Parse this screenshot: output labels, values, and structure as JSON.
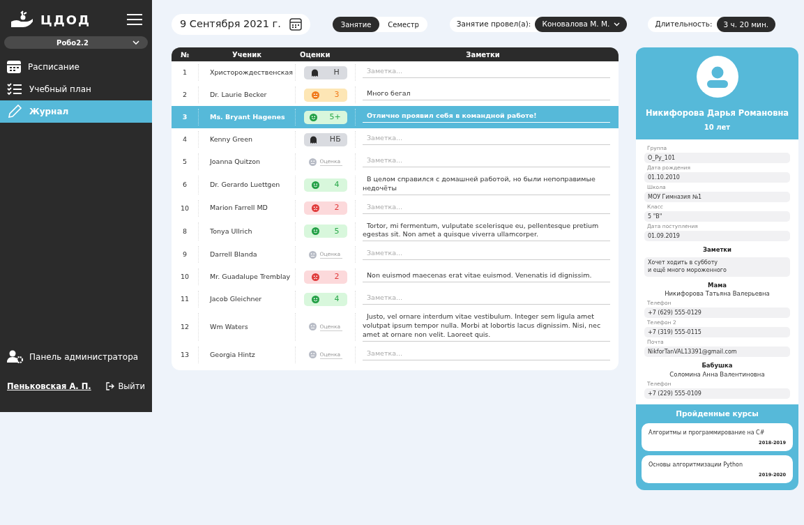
{
  "sidebar": {
    "logo": "ЦДОД",
    "group_select": "Робо2.2",
    "items": [
      {
        "label": "Расписание",
        "selected": false
      },
      {
        "label": "Учебный план",
        "selected": false
      },
      {
        "label": "Журнал",
        "selected": true
      }
    ],
    "admin": "Панель администратора",
    "user": "Пеньковская А. П.",
    "logout": "Выйти"
  },
  "toolbar": {
    "date": "9 Сентября 2021 г.",
    "modes": [
      {
        "label": "Занятие",
        "selected": true
      },
      {
        "label": "Семестр",
        "selected": false
      }
    ],
    "teacher_label": "Занятие провел(а):",
    "teacher": "Коновалова М. М.",
    "duration_label": "Длительность:",
    "duration": "3 ч. 20 мин."
  },
  "table": {
    "columns": [
      "№",
      "Ученик",
      "Оценки",
      "Заметки"
    ],
    "rows": [
      {
        "num": "1",
        "student": "Христорождественская",
        "grade": {
          "kind": "absent",
          "text": "Н"
        },
        "note": {
          "placeholder": "Заметка..."
        },
        "selected": false
      },
      {
        "num": "2",
        "student": "Dr. Laurie Becker",
        "grade": {
          "kind": "ok",
          "text": "3"
        },
        "note": {
          "value": "Много бегал"
        },
        "selected": false
      },
      {
        "num": "3",
        "student": "Ms. Bryant Hagenes",
        "grade": {
          "kind": "good",
          "text": "5+"
        },
        "note": {
          "value": "Отлично проявил себя в командной работе!"
        },
        "selected": true
      },
      {
        "num": "4",
        "student": "Kenny Green",
        "grade": {
          "kind": "absent",
          "text": "НБ"
        },
        "note": {
          "placeholder": "Заметка..."
        },
        "selected": false
      },
      {
        "num": "5",
        "student": "Joanna Quitzon",
        "grade": {
          "kind": "empty",
          "placeholder": "Оценка"
        },
        "note": {
          "placeholder": "Заметка..."
        },
        "selected": false
      },
      {
        "num": "6",
        "student": "Dr. Gerardo Luettgen",
        "grade": {
          "kind": "good",
          "text": "4"
        },
        "note": {
          "value": "В целом справился с домашней работой, но были непоправимые недочёты"
        },
        "selected": false
      },
      {
        "num": "10",
        "student": "Marion Farrell MD",
        "grade": {
          "kind": "bad",
          "text": "2"
        },
        "note": {
          "placeholder": "Заметка..."
        },
        "selected": false
      },
      {
        "num": "8",
        "student": "Tonya Ullrich",
        "grade": {
          "kind": "good",
          "text": "5"
        },
        "note": {
          "value": "Tortor, mi fermentum, vulputate scelerisque eu, pellentesque pretium egestas sit. Non amet a quisque viverra ullamcorper."
        },
        "selected": false
      },
      {
        "num": "9",
        "student": "Darrell Blanda",
        "grade": {
          "kind": "empty",
          "placeholder": "Оценка"
        },
        "note": {
          "placeholder": "Заметка..."
        },
        "selected": false
      },
      {
        "num": "10",
        "student": "Mr. Guadalupe Tremblay",
        "grade": {
          "kind": "bad",
          "text": "2"
        },
        "note": {
          "value": "Non euismod maecenas erat vitae euismod. Venenatis id dignissim."
        },
        "selected": false
      },
      {
        "num": "11",
        "student": "Jacob Gleichner",
        "grade": {
          "kind": "good",
          "text": "4"
        },
        "note": {
          "placeholder": "Заметка..."
        },
        "selected": false
      },
      {
        "num": "12",
        "student": "Wm Waters",
        "grade": {
          "kind": "empty",
          "placeholder": "Оценка"
        },
        "note": {
          "value": "Justo, vel ornare interdum vitae vestibulum. Integer sem ligula amet volutpat ipsum tempor nulla. Morbi at lobortis lacus dignissim. Nisi, nec amet at ornare non velit. Laoreet quis."
        },
        "selected": false
      },
      {
        "num": "13",
        "student": "Georgia Hintz",
        "grade": {
          "kind": "empty",
          "placeholder": "Оценка"
        },
        "note": {
          "placeholder": "Заметка..."
        },
        "selected": false
      }
    ]
  },
  "profile": {
    "name": "Никифорова Дарья Романовна",
    "age": "10 лет",
    "fields": [
      {
        "label": "Группа",
        "value": "O_Py_101"
      },
      {
        "label": "Дата рождения",
        "value": "01.10.2010"
      },
      {
        "label": "Школа",
        "value": "МОУ Гимназия №1"
      },
      {
        "label": "Класс",
        "value": "5 \"В\""
      },
      {
        "label": "Дата поступления",
        "value": "01.09.2019"
      }
    ],
    "notes_title": "Заметки",
    "notes": "Хочет ходить в субботу\nи ещё много мороженного",
    "contacts": [
      {
        "role": "Мама",
        "name": "Никифорова Татьяна Валерьевна",
        "fields": [
          {
            "label": "Телефон",
            "value": "+7 (629) 555-0129"
          },
          {
            "label": "Телефон 2",
            "value": "+7 (319) 555-0115"
          },
          {
            "label": "Почта",
            "value": "NikforTanVAL13391@gmail.com"
          }
        ]
      },
      {
        "role": "Бабушка",
        "name": "Соломина Анна Валентиновна",
        "fields": [
          {
            "label": "Телефон",
            "value": "+7 (229) 555-0109"
          }
        ]
      }
    ],
    "courses_title": "Пройденные курсы",
    "courses": [
      {
        "title": "Алгоритмы и программирование на C#",
        "years": "2018-2019"
      },
      {
        "title": "Основы алгоритмизации Python",
        "years": "2019-2020"
      }
    ]
  }
}
